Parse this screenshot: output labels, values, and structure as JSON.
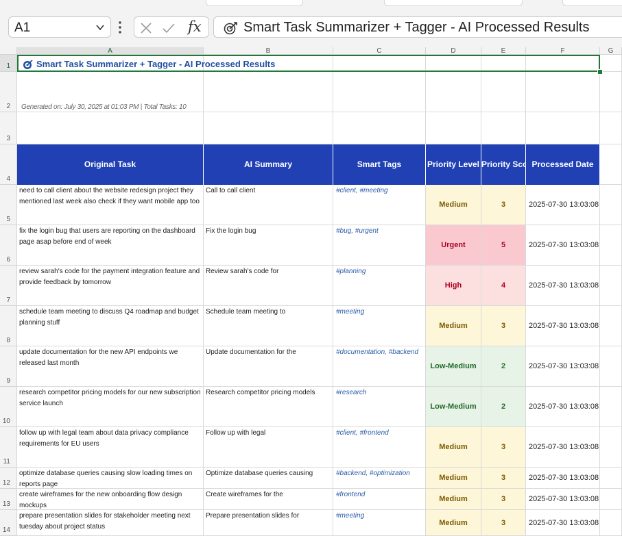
{
  "formula_bar": {
    "name_box": "A1",
    "cancel_icon": "close-icon",
    "enter_icon": "check-icon",
    "fx_label": "fx",
    "content": "Smart Task Summarizer + Tagger - AI Processed Results"
  },
  "columns": [
    "A",
    "B",
    "C",
    "D",
    "E",
    "F",
    "G"
  ],
  "rows": [
    "1",
    "2",
    "3",
    "4",
    "5",
    "6",
    "7",
    "8",
    "9",
    "10",
    "11",
    "12",
    "13",
    "14"
  ],
  "sheet": {
    "title": "Smart Task Summarizer + Tagger - AI Processed Results",
    "generated": "Generated on: July 30, 2025 at 01:03 PM | Total Tasks: 10",
    "headers": [
      "Original Task",
      "AI Summary",
      "Smart Tags",
      "Priority Level",
      "Priority Score",
      "Processed Date"
    ],
    "tasks": [
      {
        "task": "need to call client about the website redesign project they mentioned last week also check if they want mobile app too",
        "summary": "Call to call client",
        "tags": "#client, #meeting",
        "level": "Medium",
        "score": "3",
        "date": "2025-07-30 13:03:08"
      },
      {
        "task": "fix the login bug that users are reporting on the dashboard page asap before end of week",
        "summary": "Fix the login bug",
        "tags": "#bug, #urgent",
        "level": "Urgent",
        "score": "5",
        "date": "2025-07-30 13:03:08"
      },
      {
        "task": "review sarah's code for the payment integration feature and provide feedback by tomorrow",
        "summary": "Review sarah's code for",
        "tags": "#planning",
        "level": "High",
        "score": "4",
        "date": "2025-07-30 13:03:08"
      },
      {
        "task": "schedule team meeting to discuss Q4 roadmap and budget planning stuff",
        "summary": "Schedule team meeting to",
        "tags": "#meeting",
        "level": "Medium",
        "score": "3",
        "date": "2025-07-30 13:03:08"
      },
      {
        "task": "update documentation for the new API endpoints we released last month",
        "summary": "Update documentation for the",
        "tags": "#documentation, #backend",
        "level": "Low-Medium",
        "score": "2",
        "date": "2025-07-30 13:03:08"
      },
      {
        "task": "research competitor pricing models for our new subscription service launch",
        "summary": "Research competitor pricing models",
        "tags": "#research",
        "level": "Low-Medium",
        "score": "2",
        "date": "2025-07-30 13:03:08"
      },
      {
        "task": "follow up with legal team about data privacy compliance requirements for EU users",
        "summary": "Follow up with legal",
        "tags": "#client, #frontend",
        "level": "Medium",
        "score": "3",
        "date": "2025-07-30 13:03:08"
      },
      {
        "task": "optimize database queries causing slow loading times on reports page",
        "summary": "Optimize database queries causing",
        "tags": "#backend, #optimization",
        "level": "Medium",
        "score": "3",
        "date": "2025-07-30 13:03:08"
      },
      {
        "task": "create wireframes for the new onboarding flow design mockups",
        "summary": "Create wireframes for the",
        "tags": "#frontend",
        "level": "Medium",
        "score": "3",
        "date": "2025-07-30 13:03:08"
      },
      {
        "task": "prepare presentation slides for stakeholder meeting next tuesday about project status",
        "summary": "Prepare presentation slides for",
        "tags": "#meeting",
        "level": "Medium",
        "score": "3",
        "date": "2025-07-30 13:03:08"
      }
    ]
  },
  "colors": {
    "header_bg": "#2040b4",
    "title_text": "#1f4e9f",
    "medium_bg": "#fdf6d8",
    "medium_text": "#7a5a00",
    "urgent_bg": "#f9c9cf",
    "urgent_text": "#b00020",
    "high_bg": "#fce0e0",
    "high_text": "#b00020",
    "lowmed_bg": "#e7f3e7",
    "lowmed_text": "#1f6a2a"
  }
}
